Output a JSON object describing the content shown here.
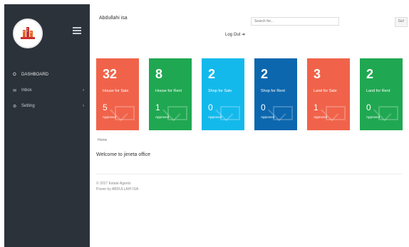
{
  "sidebar": {
    "items": [
      {
        "label": "DASHBOARD",
        "icon": "dashboard-icon",
        "glyph": "⛭",
        "arrow": ""
      },
      {
        "label": "Inbox",
        "icon": "inbox-icon",
        "glyph": "✉",
        "arrow": "›"
      },
      {
        "label": "Setting",
        "icon": "gear-icon",
        "glyph": "⚙",
        "arrow": "›"
      }
    ]
  },
  "header": {
    "user_name": "Abdullahi isa",
    "search_placeholder": "Search for...",
    "go_label": "Go!",
    "logout_label": "Log Out ➔"
  },
  "cards": [
    {
      "count": "32",
      "label": "House for Sale",
      "approved_count": "5",
      "approved_label": "Approved",
      "color": "#f0634a"
    },
    {
      "count": "8",
      "label": "House for Rent",
      "approved_count": "1",
      "approved_label": "Approved",
      "color": "#1fa851"
    },
    {
      "count": "2",
      "label": "Shop for Sale",
      "approved_count": "0",
      "approved_label": "Approved",
      "color": "#14b9ec"
    },
    {
      "count": "2",
      "label": "Shop for Rent",
      "approved_count": "0",
      "approved_label": "Approved",
      "color": "#0c67ae"
    },
    {
      "count": "3",
      "label": "Land for Sale",
      "approved_count": "1",
      "approved_label": "Approved",
      "color": "#f0634a"
    },
    {
      "count": "2",
      "label": "Land for Rent",
      "approved_count": "0",
      "approved_label": "Approved",
      "color": "#1fa851"
    }
  ],
  "breadcrumb": "Home",
  "welcome": "Welcome to jimeta office",
  "footer": {
    "line1": "© 2017 Estate Agents",
    "line2": "Power by ABDULLAHI ISA"
  }
}
